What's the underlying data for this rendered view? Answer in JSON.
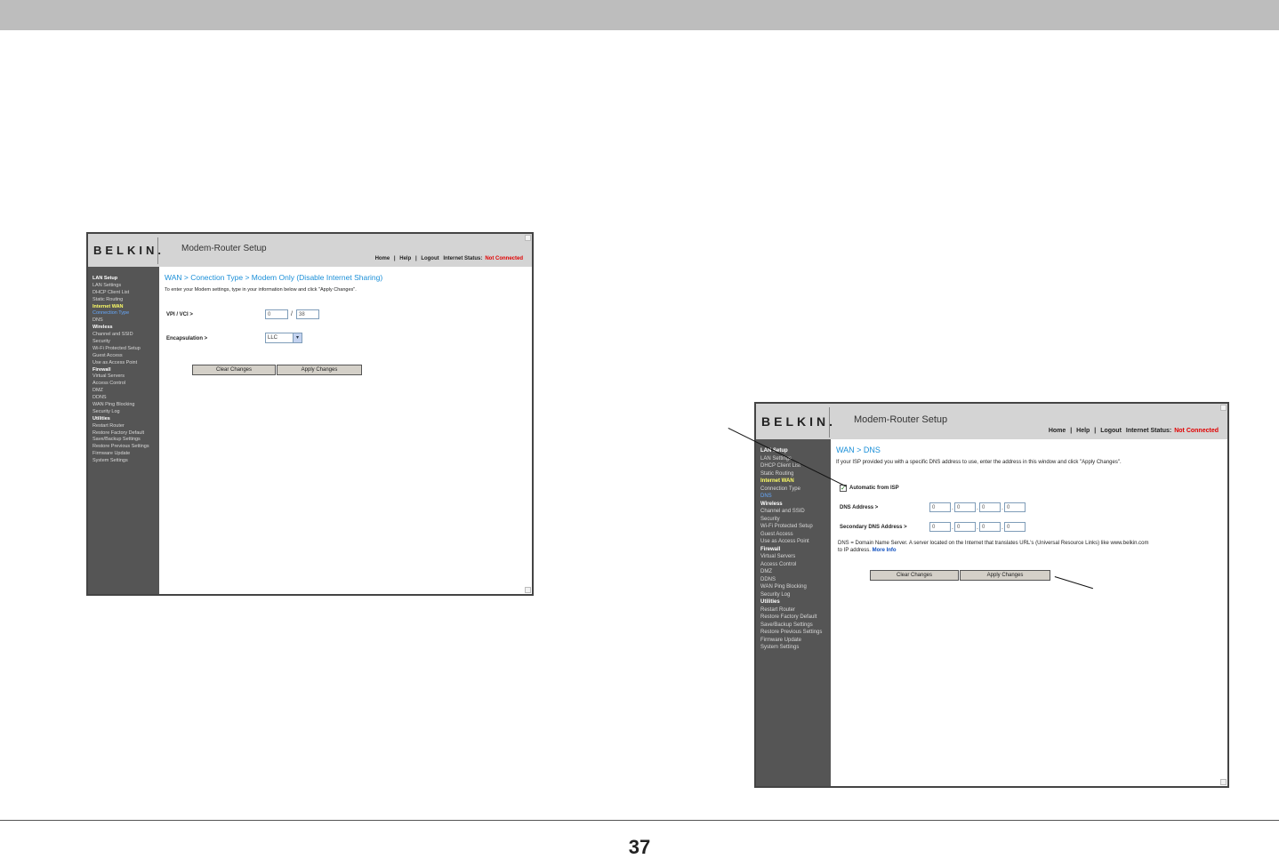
{
  "page_number": "37",
  "common": {
    "logo": "BELKIN.",
    "header_title": "Modem-Router Setup",
    "links": {
      "home": "Home",
      "help": "Help",
      "logout": "Logout",
      "sep": "|",
      "status_label": "Internet Status:",
      "status_value": "Not Connected"
    },
    "sidebar": [
      {
        "label": "LAN Setup",
        "type": "head"
      },
      {
        "label": "LAN Settings",
        "type": "item"
      },
      {
        "label": "DHCP Client List",
        "type": "item"
      },
      {
        "label": "Static Routing",
        "type": "item"
      },
      {
        "label": "Internet WAN",
        "type": "active"
      },
      {
        "label": "Connection Type",
        "type": "item"
      },
      {
        "label": "DNS",
        "type": "item"
      },
      {
        "label": "Wireless",
        "type": "head"
      },
      {
        "label": "Channel and SSID",
        "type": "item"
      },
      {
        "label": "Security",
        "type": "item"
      },
      {
        "label": "Wi-Fi Protected Setup",
        "type": "item"
      },
      {
        "label": "Guest Access",
        "type": "item"
      },
      {
        "label": "Use as Access Point",
        "type": "item"
      },
      {
        "label": "Firewall",
        "type": "head"
      },
      {
        "label": "Virtual Servers",
        "type": "item"
      },
      {
        "label": "Access Control",
        "type": "item"
      },
      {
        "label": "DMZ",
        "type": "item"
      },
      {
        "label": "DDNS",
        "type": "item"
      },
      {
        "label": "WAN Ping Blocking",
        "type": "item"
      },
      {
        "label": "Security Log",
        "type": "item"
      },
      {
        "label": "Utilities",
        "type": "head"
      },
      {
        "label": "Restart Router",
        "type": "item"
      },
      {
        "label": "Restore Factory Default",
        "type": "item"
      },
      {
        "label": "Save/Backup Settings",
        "type": "item"
      },
      {
        "label": "Restore Previous Settings",
        "type": "item"
      },
      {
        "label": "Firmware Update",
        "type": "item"
      },
      {
        "label": "System Settings",
        "type": "item"
      }
    ]
  },
  "screen_a": {
    "current_sidebar_index": 5,
    "title": "WAN > Conection Type > Modem Only (Disable Internet Sharing)",
    "intro": "To enter your Modem settings, type in your information below and click \"Apply Changes\".",
    "vpi_vci_label": "VPI / VCI >",
    "vpi_value": "0",
    "vci_value": "38",
    "slash": "/",
    "encapsulation_label": "Encapsulation >",
    "encapsulation_value": "LLC",
    "clear_button": "Clear Changes",
    "apply_button": "Apply Changes"
  },
  "screen_b": {
    "current_sidebar_index": 6,
    "title": "WAN > DNS",
    "intro": "If your ISP provided you with a specific DNS address to use, enter the address in this window and click \"Apply Changes\".",
    "auto_label": "Automatic from ISP",
    "auto_checked": "✓",
    "dns_label": "DNS Address >",
    "dns_values": [
      "0",
      "0",
      "0",
      "0"
    ],
    "secondary_label": "Secondary DNS Address >",
    "secondary_values": [
      "0",
      "0",
      "0",
      "0"
    ],
    "dot": ".",
    "note": "DNS = Domain Name Server. A server located on the Internet that translates URL's (Universal Resource Links) like www.belkin.com to IP address.",
    "more_info": "More Info",
    "clear_button": "Clear Changes",
    "apply_button": "Apply Changes"
  }
}
